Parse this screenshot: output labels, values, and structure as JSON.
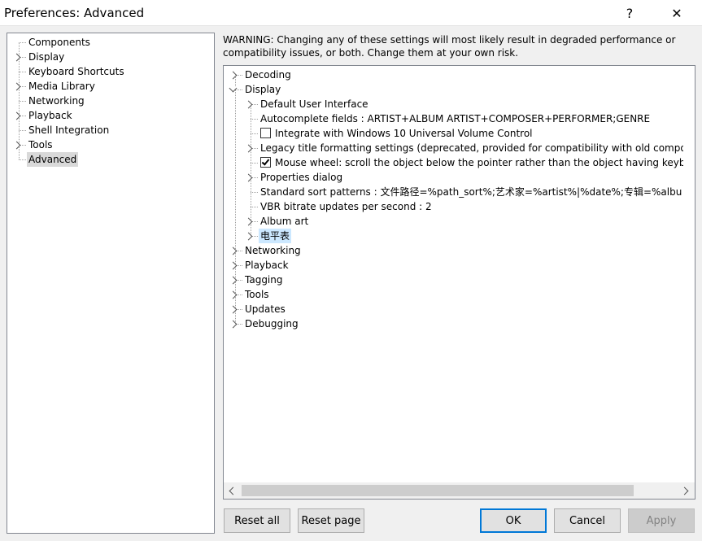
{
  "window": {
    "title": "Preferences: Advanced",
    "help_glyph": "?",
    "close_glyph": "✕"
  },
  "left_tree": {
    "items": [
      {
        "label": "Components",
        "expandable": false
      },
      {
        "label": "Display",
        "expandable": true
      },
      {
        "label": "Keyboard Shortcuts",
        "expandable": false
      },
      {
        "label": "Media Library",
        "expandable": true
      },
      {
        "label": "Networking",
        "expandable": false
      },
      {
        "label": "Playback",
        "expandable": true
      },
      {
        "label": "Shell Integration",
        "expandable": false
      },
      {
        "label": "Tools",
        "expandable": true
      },
      {
        "label": "Advanced",
        "expandable": false,
        "selected": true
      }
    ]
  },
  "warning": "WARNING: Changing any of these settings will most likely result in degraded performance or compatibility issues, or both. Change them at your own risk.",
  "advanced_tree": {
    "decoding": "Decoding",
    "display": "Display",
    "display_children": [
      {
        "label": "Default User Interface",
        "kind": "expandable"
      },
      {
        "label": "Autocomplete fields : ARTIST+ALBUM ARTIST+COMPOSER+PERFORMER;GENRE",
        "kind": "leaf"
      },
      {
        "label": "Integrate with Windows 10 Universal Volume Control",
        "kind": "checkbox",
        "checked": false
      },
      {
        "label": "Legacy title formatting settings (deprecated, provided for compatibility with old components o",
        "kind": "expandable"
      },
      {
        "label": "Mouse wheel: scroll the object below the pointer rather than the object having keyboard fo",
        "kind": "checkbox",
        "checked": true
      },
      {
        "label": "Properties dialog",
        "kind": "expandable"
      },
      {
        "label": "Standard sort patterns : 文件路径=%path_sort%;艺术家=%artist%|%date%;专辑=%albu",
        "kind": "leaf"
      },
      {
        "label": "VBR bitrate updates per second : 2",
        "kind": "leaf"
      },
      {
        "label": "Album art",
        "kind": "expandable"
      },
      {
        "label": "电平表",
        "kind": "expandable",
        "selected": true
      }
    ],
    "others": [
      "Networking",
      "Playback",
      "Tagging",
      "Tools",
      "Updates",
      "Debugging"
    ]
  },
  "buttons": {
    "reset_all": "Reset all",
    "reset_page": "Reset page",
    "ok": "OK",
    "cancel": "Cancel",
    "apply": "Apply"
  },
  "colors": {
    "selection_inactive": "#d9d9d9",
    "selection_highlight": "#cce8ff",
    "default_button_border": "#0078d7"
  }
}
